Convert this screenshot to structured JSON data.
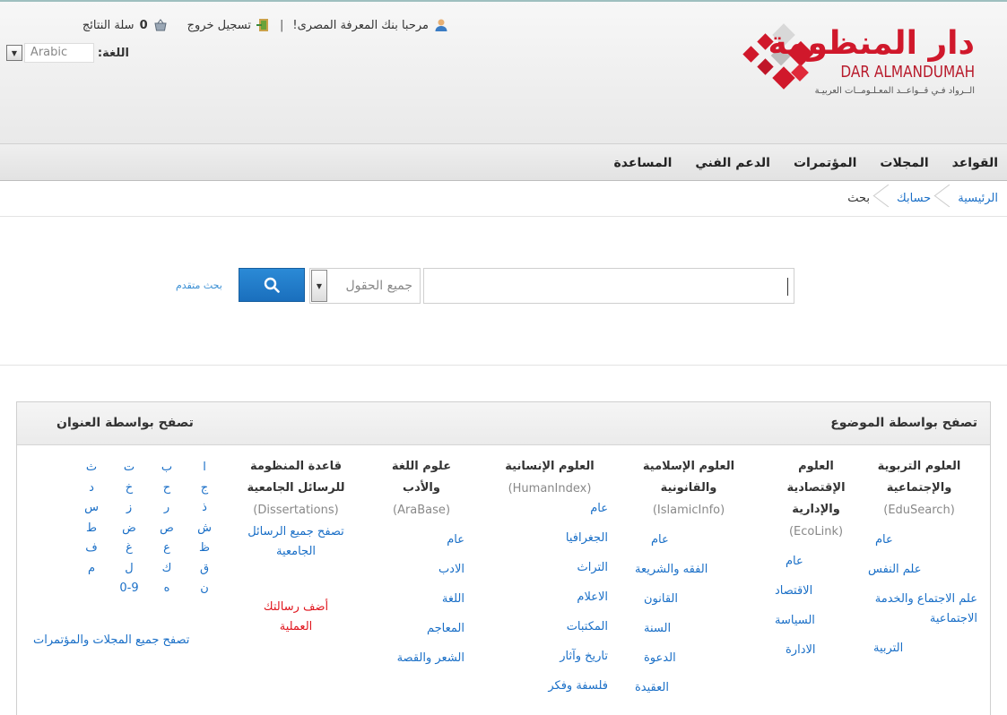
{
  "header": {
    "logo_ar": "دار المنظومة",
    "logo_en": "DAR ALMANDUMAH",
    "logo_tagline": "الــرواد فـي قــواعــد المعـلـومــات العربيـة",
    "welcome": "مرحبا بنك المعرفة المصرى!",
    "logout": "تسجيل خروج",
    "cart_count": "0",
    "cart_label": "سلة النتائج",
    "language_label": "اللغة:",
    "language_value": "Arabic"
  },
  "nav": {
    "items": [
      "القواعد",
      "المجلات",
      "المؤتمرات",
      "الدعم الفني",
      "المساعدة"
    ]
  },
  "breadcrumb": {
    "items": [
      "الرئيسية",
      "حسابك",
      "بحث"
    ]
  },
  "search": {
    "query": "",
    "field_value": "جميع الحقول",
    "advanced_label": "بحث متقدم"
  },
  "browse": {
    "by_subject": "تصفح بواسطة الموضوع",
    "by_title": "تصفح بواسطة العنوان",
    "columns": [
      {
        "title": "العلوم التربوية والإجتماعية",
        "sub": "(EduSearch)",
        "links": [
          "عام",
          "علم النفس",
          "علم الاجتماع والخدمة الاجتماعية",
          "التربية"
        ]
      },
      {
        "title": "العلوم الإقتصادية والإدارية",
        "sub": "(EcoLink)",
        "links": [
          "عام",
          "الاقتصاد",
          "السياسة",
          "الادارة"
        ]
      },
      {
        "title": "العلوم الإسلامية والقانونية",
        "sub": "(IslamicInfo)",
        "links": [
          "عام",
          "الفقه والشريعة",
          "القانون",
          "السنة",
          "الدعوة",
          "العقيدة"
        ]
      },
      {
        "title": "العلوم الإنسانية",
        "sub": "(HumanIndex)",
        "links": [
          "عام",
          "الجغرافيا",
          "التراث",
          "الاعلام",
          "المكتبات",
          "تاريخ وآثار",
          "فلسفة وفكر"
        ]
      },
      {
        "title": "علوم اللغة والأدب",
        "sub": "(AraBase)",
        "links": [
          "عام",
          "الادب",
          "اللغة",
          "المعاجم",
          "الشعر والقصة"
        ]
      },
      {
        "title": "قاعدة المنظومة للرسائل الجامعية",
        "sub": "(Dissertations)",
        "links": [
          "تصفح جميع الرسائل الجامعية"
        ],
        "red_link": "أضف رسالتك العملية"
      }
    ],
    "alphabet": [
      "ا",
      "ب",
      "ت",
      "ث",
      "ج",
      "ح",
      "خ",
      "د",
      "ذ",
      "ر",
      "ز",
      "س",
      "ش",
      "ص",
      "ض",
      "ط",
      "ظ",
      "ع",
      "غ",
      "ف",
      "ق",
      "ك",
      "ل",
      "م",
      "ن",
      "ه",
      "0-9"
    ],
    "browse_all": "تصفح جميع المجلات والمؤتمرات"
  },
  "colors": {
    "brand_red": "#d0182b",
    "link_blue": "#1a6fc7",
    "button_blue": "#1f7ac8",
    "alert_red": "#e0161e"
  }
}
